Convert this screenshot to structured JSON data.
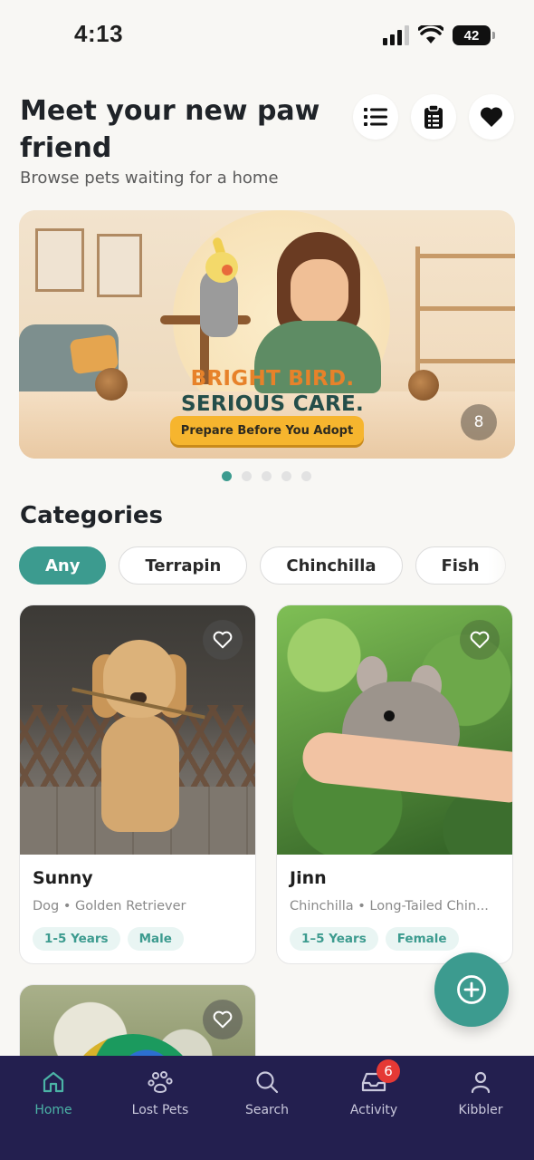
{
  "status_bar": {
    "time": "4:13",
    "battery": "42"
  },
  "header": {
    "title": "Meet your new paw friend",
    "subtitle": "Browse pets waiting for a home"
  },
  "banner": {
    "headline_1": "BRIGHT BIRD.",
    "headline_2": "SERIOUS CARE.",
    "cta": "Prepare Before You Adopt",
    "count": "8",
    "slides": 5,
    "active_slide": 1
  },
  "categories": {
    "title": "Categories",
    "chips": [
      "Any",
      "Terrapin",
      "Chinchilla",
      "Fish"
    ],
    "active": "Any"
  },
  "pets": [
    {
      "name": "Sunny",
      "meta": "Dog • Golden Retriever",
      "tags": [
        "1-5 Years",
        "Male"
      ]
    },
    {
      "name": "Jinn",
      "meta": "Chinchilla • Long-Tailed Chin...",
      "tags": [
        "1–5 Years",
        "Female"
      ]
    }
  ],
  "bottom_nav": {
    "items": [
      {
        "label": "Home",
        "icon": "home-icon",
        "active": true
      },
      {
        "label": "Lost Pets",
        "icon": "paw-icon",
        "active": false
      },
      {
        "label": "Search",
        "icon": "search-icon",
        "active": false
      },
      {
        "label": "Activity",
        "icon": "inbox-icon",
        "active": false,
        "badge": "6"
      },
      {
        "label": "Kibbler",
        "icon": "person-icon",
        "active": false
      }
    ]
  },
  "colors": {
    "accent": "#3c9b8f",
    "nav_background": "#231f4f",
    "badge": "#e53935",
    "cta": "#f6b52e"
  }
}
